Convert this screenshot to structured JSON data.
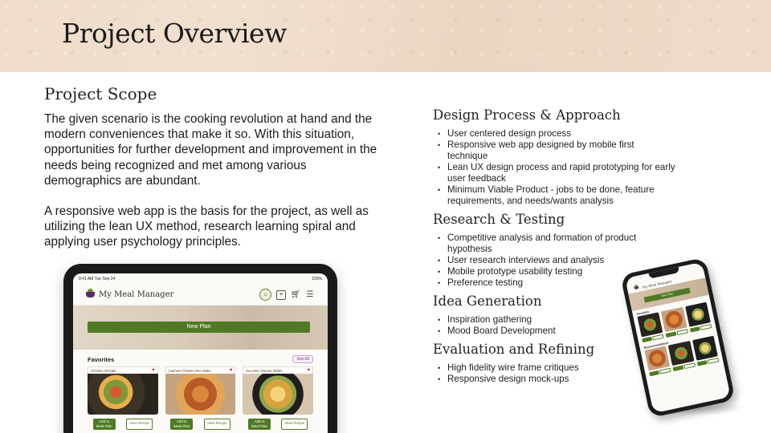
{
  "header": {
    "title": "Project Overview"
  },
  "scope": {
    "title": "Project Scope",
    "paragraph1": "The given scenario is the cooking revolution at hand and the modern conveniences that make it so. With this situation, opportunities for further development and improvement in the needs being recognized and met among various demographics are abundant.",
    "paragraph2": "A responsive web app is the basis for the project, as well as utilizing the lean UX method, research learning spiral and applying user psychology principles."
  },
  "sections": [
    {
      "title": "Design Process & Approach",
      "bullets": [
        "User centered design process",
        "Responsive web app designed by mobile first technique",
        "Lean UX design process and rapid prototyping for early user feedback",
        "Minimum Viable Product - jobs to be done, feature requirements, and needs/wants analysis"
      ]
    },
    {
      "title": "Research & Testing",
      "bullets": [
        "Competitive analysis and formation of product hypothesis",
        "User research interviews and analysis",
        "Mobile prototype usability testing",
        "Preference testing"
      ]
    },
    {
      "title": "Idea Generation",
      "bullets": [
        "Inspiration gathering",
        "Mood Board Development"
      ]
    },
    {
      "title": "Evaluation and Refining",
      "bullets": [
        "High fidelity wire frame critiques",
        "Responsive design mock-ups"
      ]
    }
  ],
  "tablet": {
    "status_time": "9:41 AM   Tue Sep 24",
    "status_right": "100%",
    "app_name": "My Meal Manager",
    "new_plan": "New Plan",
    "favorites": "Favorites",
    "see_all": "See All",
    "cards": [
      {
        "name": "Chicken Teriyaki",
        "add": "Add to Meal Plan",
        "view": "View Recipe"
      },
      {
        "name": "Cashew Chicken Rice Bake",
        "add": "Add to Meal Plan",
        "view": "View Recipe"
      },
      {
        "name": "Zucchini Cheese Skillet",
        "add": "Add to Meal Plan",
        "view": "View Recipe"
      }
    ]
  },
  "phone": {
    "app_name": "My Meal Manager",
    "new_plan": "New Plan",
    "favorites": "Favorites",
    "recommendations": "Recommendations"
  }
}
